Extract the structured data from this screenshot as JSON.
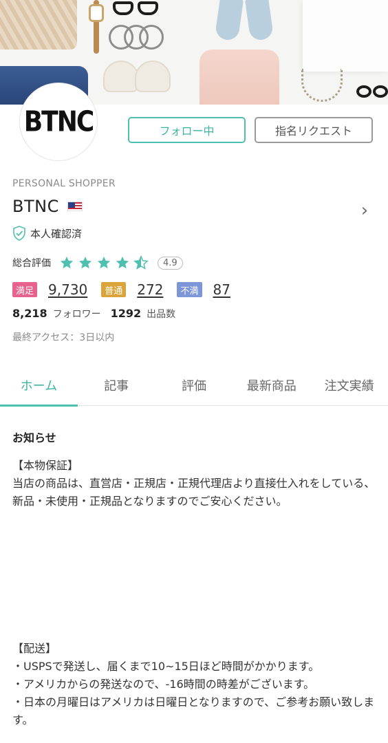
{
  "profile": {
    "avatar_text": "BTNC",
    "role": "PERSONAL SHOPPER",
    "name": "BTNC",
    "country_flag": "us-flag-icon",
    "verified_label": "本人確認済"
  },
  "actions": {
    "follow_label": "フォロー中",
    "request_label": "指名リクエスト"
  },
  "rating": {
    "label": "総合評価",
    "score": "4.9",
    "stars_value": 4.5,
    "star_color": "#4fbfb0"
  },
  "feedback": {
    "good_label": "満足",
    "good_count": "9,730",
    "neutral_label": "普通",
    "neutral_count": "272",
    "bad_label": "不満",
    "bad_count": "87"
  },
  "stats": {
    "followers_count": "8,218",
    "followers_label": "フォロワー",
    "items_count": "1292",
    "items_label": "出品数"
  },
  "last_access": "最終アクセス：3日以内",
  "tabs": [
    {
      "label": "ホーム",
      "active": true
    },
    {
      "label": "記事",
      "active": false
    },
    {
      "label": "評価",
      "active": false
    },
    {
      "label": "最新商品",
      "active": false
    },
    {
      "label": "注文実績",
      "active": false
    }
  ],
  "notice": {
    "title": "お知らせ",
    "authentic_heading": "【本物保証】",
    "authentic_text": "当店の商品は、直営店・正規店・正規代理店より直接仕入れをしている、新品・未使用・正規品となりますのでご安心ください。",
    "shipping_heading": "【配送】",
    "shipping_lines": [
      "・USPSで発送し、届くまで10~15日ほど時間がかかります。",
      "・アメリカからの発送なので、-16時間の時差がございます。",
      "・日本の月曜日はアメリカは日曜日となりますので、ご参考お願い致します。"
    ]
  },
  "colors": {
    "accent": "#4fbfb0",
    "good": "#e8628e",
    "neutral": "#dba43a",
    "bad": "#7c96d8"
  }
}
